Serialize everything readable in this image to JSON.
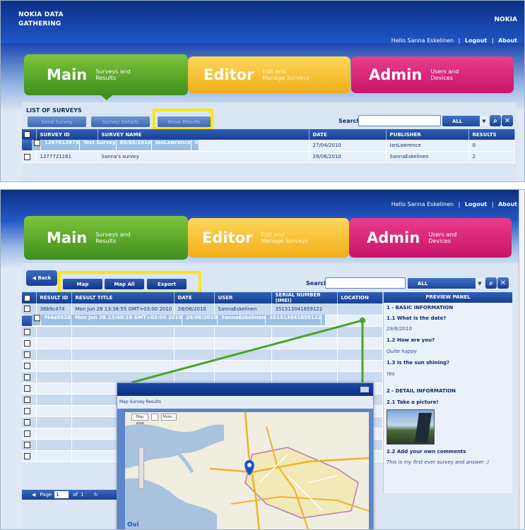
{
  "app": {
    "brand": "NOKIA DATA\nGATHERING",
    "nokia": "NOKIA",
    "greeting": "Hello Sanna Eskelinen",
    "logout": "Logout",
    "about": "About",
    "sep": "|"
  },
  "tabs": [
    {
      "big": "Main",
      "sub1": "Surveys and",
      "sub2": "Results"
    },
    {
      "big": "Editor",
      "sub1": "Edit and",
      "sub2": "Manage Surveys"
    },
    {
      "big": "Admin",
      "sub1": "Users and",
      "sub2": "Devices"
    }
  ],
  "surveys": {
    "title": "LIST OF SURVEYS",
    "buttons": [
      "Send Survey",
      "Survey Details",
      "Show Results"
    ],
    "search_label": "Search",
    "search_value": "",
    "filter": "ALL",
    "columns": [
      "SURVEY ID",
      "SURVEY NAME",
      "DATE",
      "PUBLISHER",
      "RESULTS"
    ],
    "rows": [
      [
        "1267813879",
        "Test Survey",
        "05/03/2010",
        "IanLawrence",
        "0"
      ],
      [
        "1272384669",
        "Child Birth Registration Application",
        "27/04/2010",
        "IanLawrence",
        "0"
      ],
      [
        "1277721161",
        "Sanna's survey",
        "28/06/2010",
        "SannaEskelinen",
        "2"
      ]
    ]
  },
  "results": {
    "back": "Back",
    "buttons": [
      "Map",
      "Map All",
      "Export"
    ],
    "search_label": "Search",
    "filter": "ALL",
    "columns": [
      "RESULT ID",
      "RESULT TITLE",
      "DATE",
      "USER",
      "SERIAL NUMBER (IMEI)",
      "LOCATION"
    ],
    "rows": [
      [
        "36b9c474",
        "Mon Jun 28 13:38:55 GMT+03:00 2010",
        "28/06/2010",
        "SannaEskelinen",
        "351513041859122",
        ""
      ],
      [
        "f44a9528",
        "Mon Jun 28 13:40:18 GMT+03:00 2010",
        "28/06/2010",
        "SannaEskelinen",
        "351513041859122",
        ""
      ]
    ],
    "pager": {
      "page_label": "Page",
      "page_value": "1",
      "of_label": "of",
      "total": "1"
    }
  },
  "preview": {
    "title": "PREVIEW PANEL",
    "section1": "1 - BASIC INFORMATION",
    "q1": "1.1 What is the date?",
    "a1": "29/6/2010",
    "q2": "1.2 How are you?",
    "a2": "Quite happy",
    "q3": "1.3 Is the sun shining?",
    "a3": "Yes",
    "section2": "2 - DETAIL INFORMATION",
    "q4": "2.1 Take a picture!",
    "q5": "2.2 Add your own comments",
    "a5": "This is my first ever survey and answer :)"
  },
  "map": {
    "title": "Map Survey Results",
    "view_btn": "Map view",
    "more_btn": "More...",
    "logo": "Ovi"
  },
  "colors": {
    "main": "#4fa12a",
    "editor": "#f5bd2a",
    "admin": "#d8207a",
    "highlight": "#ffe600",
    "header": "#1a4fb8"
  }
}
